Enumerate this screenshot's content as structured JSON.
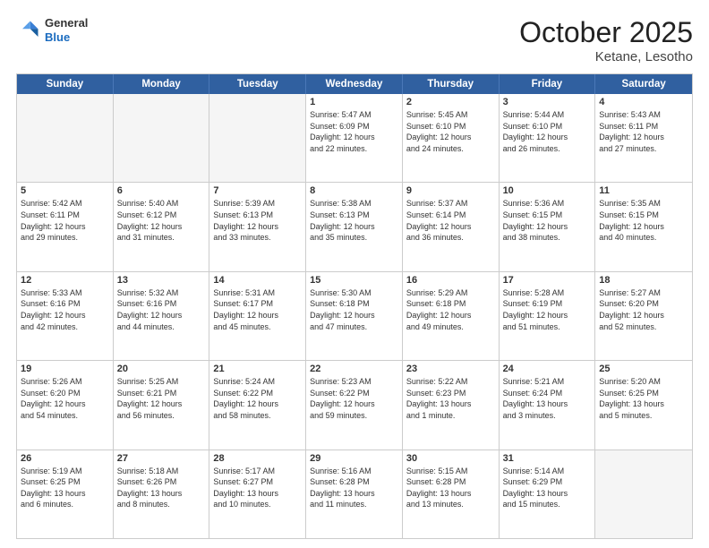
{
  "header": {
    "logo": {
      "general": "General",
      "blue": "Blue"
    },
    "title": "October 2025",
    "location": "Ketane, Lesotho"
  },
  "days_of_week": [
    "Sunday",
    "Monday",
    "Tuesday",
    "Wednesday",
    "Thursday",
    "Friday",
    "Saturday"
  ],
  "rows": [
    [
      {
        "day": "",
        "content": "",
        "empty": true
      },
      {
        "day": "",
        "content": "",
        "empty": true
      },
      {
        "day": "",
        "content": "",
        "empty": true
      },
      {
        "day": "1",
        "content": "Sunrise: 5:47 AM\nSunset: 6:09 PM\nDaylight: 12 hours\nand 22 minutes."
      },
      {
        "day": "2",
        "content": "Sunrise: 5:45 AM\nSunset: 6:10 PM\nDaylight: 12 hours\nand 24 minutes."
      },
      {
        "day": "3",
        "content": "Sunrise: 5:44 AM\nSunset: 6:10 PM\nDaylight: 12 hours\nand 26 minutes."
      },
      {
        "day": "4",
        "content": "Sunrise: 5:43 AM\nSunset: 6:11 PM\nDaylight: 12 hours\nand 27 minutes."
      }
    ],
    [
      {
        "day": "5",
        "content": "Sunrise: 5:42 AM\nSunset: 6:11 PM\nDaylight: 12 hours\nand 29 minutes."
      },
      {
        "day": "6",
        "content": "Sunrise: 5:40 AM\nSunset: 6:12 PM\nDaylight: 12 hours\nand 31 minutes."
      },
      {
        "day": "7",
        "content": "Sunrise: 5:39 AM\nSunset: 6:13 PM\nDaylight: 12 hours\nand 33 minutes."
      },
      {
        "day": "8",
        "content": "Sunrise: 5:38 AM\nSunset: 6:13 PM\nDaylight: 12 hours\nand 35 minutes."
      },
      {
        "day": "9",
        "content": "Sunrise: 5:37 AM\nSunset: 6:14 PM\nDaylight: 12 hours\nand 36 minutes."
      },
      {
        "day": "10",
        "content": "Sunrise: 5:36 AM\nSunset: 6:15 PM\nDaylight: 12 hours\nand 38 minutes."
      },
      {
        "day": "11",
        "content": "Sunrise: 5:35 AM\nSunset: 6:15 PM\nDaylight: 12 hours\nand 40 minutes."
      }
    ],
    [
      {
        "day": "12",
        "content": "Sunrise: 5:33 AM\nSunset: 6:16 PM\nDaylight: 12 hours\nand 42 minutes."
      },
      {
        "day": "13",
        "content": "Sunrise: 5:32 AM\nSunset: 6:16 PM\nDaylight: 12 hours\nand 44 minutes."
      },
      {
        "day": "14",
        "content": "Sunrise: 5:31 AM\nSunset: 6:17 PM\nDaylight: 12 hours\nand 45 minutes."
      },
      {
        "day": "15",
        "content": "Sunrise: 5:30 AM\nSunset: 6:18 PM\nDaylight: 12 hours\nand 47 minutes."
      },
      {
        "day": "16",
        "content": "Sunrise: 5:29 AM\nSunset: 6:18 PM\nDaylight: 12 hours\nand 49 minutes."
      },
      {
        "day": "17",
        "content": "Sunrise: 5:28 AM\nSunset: 6:19 PM\nDaylight: 12 hours\nand 51 minutes."
      },
      {
        "day": "18",
        "content": "Sunrise: 5:27 AM\nSunset: 6:20 PM\nDaylight: 12 hours\nand 52 minutes."
      }
    ],
    [
      {
        "day": "19",
        "content": "Sunrise: 5:26 AM\nSunset: 6:20 PM\nDaylight: 12 hours\nand 54 minutes."
      },
      {
        "day": "20",
        "content": "Sunrise: 5:25 AM\nSunset: 6:21 PM\nDaylight: 12 hours\nand 56 minutes."
      },
      {
        "day": "21",
        "content": "Sunrise: 5:24 AM\nSunset: 6:22 PM\nDaylight: 12 hours\nand 58 minutes."
      },
      {
        "day": "22",
        "content": "Sunrise: 5:23 AM\nSunset: 6:22 PM\nDaylight: 12 hours\nand 59 minutes."
      },
      {
        "day": "23",
        "content": "Sunrise: 5:22 AM\nSunset: 6:23 PM\nDaylight: 13 hours\nand 1 minute."
      },
      {
        "day": "24",
        "content": "Sunrise: 5:21 AM\nSunset: 6:24 PM\nDaylight: 13 hours\nand 3 minutes."
      },
      {
        "day": "25",
        "content": "Sunrise: 5:20 AM\nSunset: 6:25 PM\nDaylight: 13 hours\nand 5 minutes."
      }
    ],
    [
      {
        "day": "26",
        "content": "Sunrise: 5:19 AM\nSunset: 6:25 PM\nDaylight: 13 hours\nand 6 minutes."
      },
      {
        "day": "27",
        "content": "Sunrise: 5:18 AM\nSunset: 6:26 PM\nDaylight: 13 hours\nand 8 minutes."
      },
      {
        "day": "28",
        "content": "Sunrise: 5:17 AM\nSunset: 6:27 PM\nDaylight: 13 hours\nand 10 minutes."
      },
      {
        "day": "29",
        "content": "Sunrise: 5:16 AM\nSunset: 6:28 PM\nDaylight: 13 hours\nand 11 minutes."
      },
      {
        "day": "30",
        "content": "Sunrise: 5:15 AM\nSunset: 6:28 PM\nDaylight: 13 hours\nand 13 minutes."
      },
      {
        "day": "31",
        "content": "Sunrise: 5:14 AM\nSunset: 6:29 PM\nDaylight: 13 hours\nand 15 minutes."
      },
      {
        "day": "",
        "content": "",
        "empty": true
      }
    ]
  ]
}
